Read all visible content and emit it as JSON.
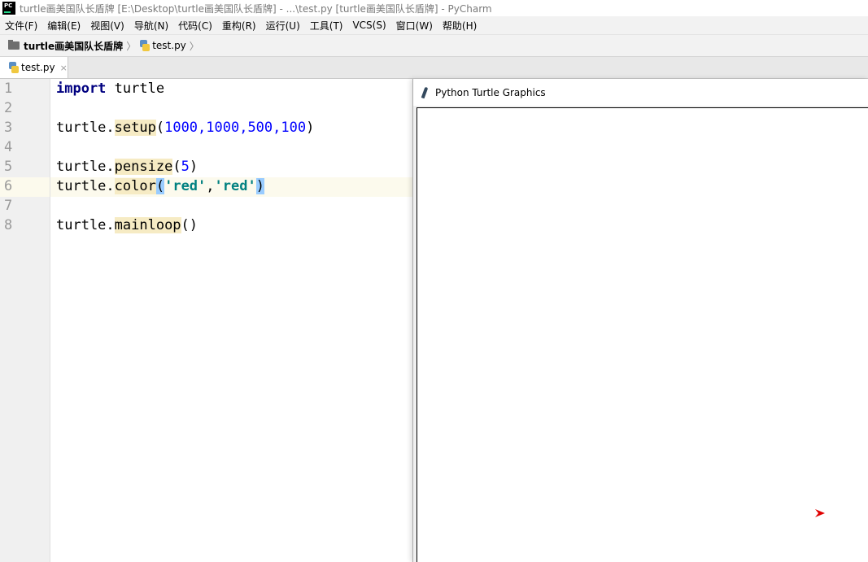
{
  "window": {
    "title": "turtle画美国队长盾牌 [E:\\Desktop\\turtle画美国队长盾牌] - ...\\test.py [turtle画美国队长盾牌] - PyCharm",
    "logo_text": "PC"
  },
  "menu": {
    "items": [
      "文件(F)",
      "编辑(E)",
      "视图(V)",
      "导航(N)",
      "代码(C)",
      "重构(R)",
      "运行(U)",
      "工具(T)",
      "VCS(S)",
      "窗口(W)",
      "帮助(H)"
    ]
  },
  "breadcrumb": {
    "project": "turtle画美国队长盾牌",
    "file": "test.py",
    "separator": "〉"
  },
  "tabs": [
    {
      "label": "test.py",
      "close": "×",
      "active": true
    }
  ],
  "editor": {
    "line_numbers": [
      "1",
      "2",
      "3",
      "4",
      "5",
      "6",
      "7",
      "8"
    ],
    "caret_line": 6,
    "lines": [
      {
        "kw": "import",
        "rest": " turtle"
      },
      {},
      {
        "obj": "turtle.",
        "fn": "setup",
        "open": "(",
        "args": "1000,1000,500,100",
        "close": ")"
      },
      {},
      {
        "obj": "turtle.",
        "fn": "pensize",
        "open": "(",
        "args": "5",
        "close": ")"
      },
      {
        "obj": "turtle.",
        "fn": "color",
        "open": "(",
        "str1": "'red'",
        "comma": ",",
        "str2": "'red'",
        "close": ")"
      },
      {},
      {
        "obj": "turtle.",
        "fn": "mainloop",
        "open": "(",
        "close": ")"
      }
    ]
  },
  "turtle_window": {
    "title": "Python Turtle Graphics",
    "icon": "feather-icon",
    "cursor_color": "#e00000"
  },
  "colors": {
    "keyword": "#000080",
    "number": "#0000ff",
    "string": "#008080",
    "caret_row": "#fcfaed",
    "brace_match": "#99ccff"
  }
}
